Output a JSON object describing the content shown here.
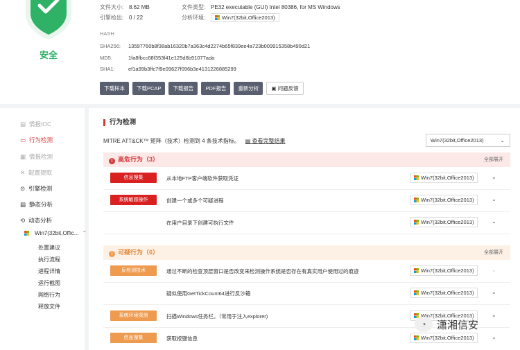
{
  "summary": {
    "verdict": "安全",
    "file_size_label": "文件大小:",
    "file_size": "8.62 MB",
    "file_type_label": "文件类型:",
    "file_type": "PE32 executable (GUI) Intel 80386, for MS Windows",
    "engine_label": "引擎检出:",
    "engine_value": "0 / 22",
    "env_label": "分析环境:",
    "env_value": "Win7(32bit,Office2013)",
    "hash_title": "HASH",
    "sha256_label": "SHA256:",
    "sha256": "13597760b8f38ab16320b7a363c4d2274b65f839ee4a723b009915358b490d21",
    "md5_label": "MD5:",
    "md5": "1fa8fbcc68f353f41e125d6b91077ada",
    "sha1_label": "SHA1:",
    "sha1": "ef1a99b3ffc7f9e09627f096b3e4131226885299"
  },
  "actions": {
    "download_sample": "下载样本",
    "download_pcap": "下载PCAP",
    "download_report": "下载报告",
    "pdf_report": "PDF报告",
    "reanalyze": "重新分析",
    "feedback": "问题反馈"
  },
  "sidebar": {
    "items": [
      {
        "label": "情报IOC"
      },
      {
        "label": "行为检测"
      },
      {
        "label": "情报检测"
      },
      {
        "label": "配置提取"
      },
      {
        "label": "引擎检测"
      },
      {
        "label": "静态分析"
      },
      {
        "label": "动态分析"
      }
    ],
    "env_label": "Win7(32bit,Offic...",
    "subitems": [
      "处置建议",
      "执行流程",
      "进程详情",
      "运行截图",
      "网络行为",
      "释放文件"
    ]
  },
  "main": {
    "section_title": "行为检测",
    "mitre_text": "MITRE ATT&CK™ 矩阵（技术）检测到 4 条技术指标。",
    "mitre_link": "查看完整结果",
    "env_select": "Win7(32bit,Office2013)",
    "expand_all": "全部展开",
    "high_group": {
      "title": "高危行为（3）",
      "icon": "!"
    },
    "suspicious_group": {
      "title": "可疑行为（6）",
      "icon": "!"
    },
    "high_rows": [
      {
        "tag": "信息搜集",
        "desc": "从本地FTP客户端软件获取凭证",
        "env": "Win7(32bit,Office2013)"
      },
      {
        "tag": "系统敏感操作",
        "desc": "创建一个或多个可疑进程",
        "env": "Win7(32bit,Office2013)"
      },
      {
        "tag": "",
        "desc": "在用户目录下创建可执行文件",
        "env": "Win7(32bit,Office2013)"
      }
    ],
    "sus_rows": [
      {
        "tag": "反检测技术",
        "desc": "通过不断的检查顶层窗口是否改变来检测操作系统是否存在有真实用户使用过的痕迹",
        "env": "Win7(32bit,Office2013)"
      },
      {
        "tag": "",
        "desc": "疑似使用GetTickCount64进行反沙箱",
        "env": "Win7(32bit,Office2013)"
      },
      {
        "tag": "系统环境探测",
        "desc": "扫描Windows任务栏。（常用于注入explorer)",
        "env": "Win7(32bit,Office2013)"
      },
      {
        "tag": "信息搜集",
        "desc": "获取按键信息",
        "env": "Win7(32bit,Office2013)"
      }
    ]
  },
  "watermark": "潇湘信安",
  "colors": {
    "accent": "#d23b3b",
    "safe": "#2fb166",
    "suspicious": "#ee9a4f"
  }
}
